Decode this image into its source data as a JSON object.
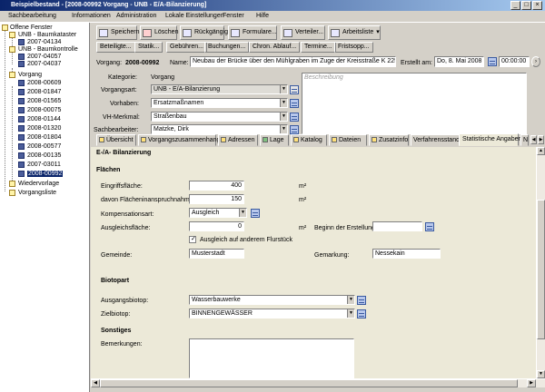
{
  "window": {
    "title": "Beispielbestand - [2008-00992 Vorgang - UNB - E/A-Bilanzierung]",
    "controls": [
      "_",
      "□",
      "×"
    ]
  },
  "menu": [
    "Sachbearbeitung",
    "Informationen",
    "Administration",
    "Lokale Einstellungen",
    "Fenster",
    "Hilfe"
  ],
  "toolbar": {
    "save": "Speichern",
    "delete": "Löschen",
    "undo": "Rückgängig",
    "forms": "Formulare...",
    "distributor": "Verteiler...",
    "worklist": "Arbeitsliste"
  },
  "subtabs": [
    "Beteiligte...",
    "Statik...",
    "Gebühren...",
    "Buchungen...",
    "Chron. Ablauf...",
    "Termine...",
    "Fristsopp..."
  ],
  "record": {
    "label": "Vorgang:",
    "number": "2008-00992",
    "name_label": "Name:",
    "name": "Neubau der Brücke über den Mühlgraben im Zuge der Kreisstraße K 225 i",
    "created_label": "Erstellt am:",
    "created_date": "Do, 8. Mai 2008",
    "created_time": "00:00:00"
  },
  "meta": {
    "category_label": "Kategorie:",
    "category": "Vorgang",
    "type_label": "Vorgangsart:",
    "type": "UNB - E/A-Bilanzierung",
    "project_label": "Vorhaben:",
    "project": "Ersatzmaßnamen",
    "vh_label": "VH-Merkmal:",
    "vh": "Straßenbau",
    "handler_label": "Sachbearbeiter:",
    "handler": "Matzke, Dirk",
    "description_placeholder": "Beschreibung"
  },
  "main_tabs": [
    "Übersicht",
    "Vorgangszusammenhang",
    "Adressen",
    "Lage",
    "Katalog",
    "Dateien",
    "Zusatzinfo",
    "Verfahrensstand",
    "Statistische Angaben"
  ],
  "overflow_tab": "N",
  "form": {
    "heading": "E-/A- Bilanzierung",
    "flaechen": "Flächen",
    "eingriff_label": "Eingriffsfläche:",
    "eingriff": "400",
    "unit": "m²",
    "davon_label": "davon Flächeninanspruchnahme:",
    "davon": "150",
    "kompensation_label": "Kompensationsart:",
    "kompensation": "Ausgleich",
    "ausgleich_label": "Ausgleichsfläche:",
    "ausgleich": "0",
    "beginn_label": "Beginn der Erstellung:",
    "ausgleich_checkbox": "Ausgleich auf anderem Flurstück",
    "gemeinde_label": "Gemeinde:",
    "gemeinde": "Musterstadt",
    "gemarkung_label": "Gemarkung:",
    "gemarkung": "Nessekain",
    "biotopart": "Biotopart",
    "ausgangsbiotop_label": "Ausgangsbiotop:",
    "ausgangsbiotop": "Wasserbauwerke",
    "zielbiotop_label": "Zielbiotop:",
    "zielbiotop": "BINNENGEWÄSSER",
    "sonstiges": "Sonstiges",
    "bemerkungen_label": "Bemerkungen:"
  },
  "tree": {
    "root": "Offene Fenster",
    "group1": "UNB - Baumkataster",
    "g1items": [
      "2007-04134"
    ],
    "group2": "UNB - Baumkontrolle",
    "g2items": [
      "2007-04057",
      "2007-04037"
    ],
    "group3": "Vorgang",
    "g3items": [
      "2008-00609",
      "2008-01847",
      "2008-01565",
      "2008-00075",
      "2008-01144",
      "2008-01320",
      "2008-01804",
      "2008-00577",
      "2008-00135",
      "2007-03011",
      "2008-00992"
    ],
    "resubmission": "Wiedervorlage",
    "caselist": "Vorgangsliste"
  }
}
